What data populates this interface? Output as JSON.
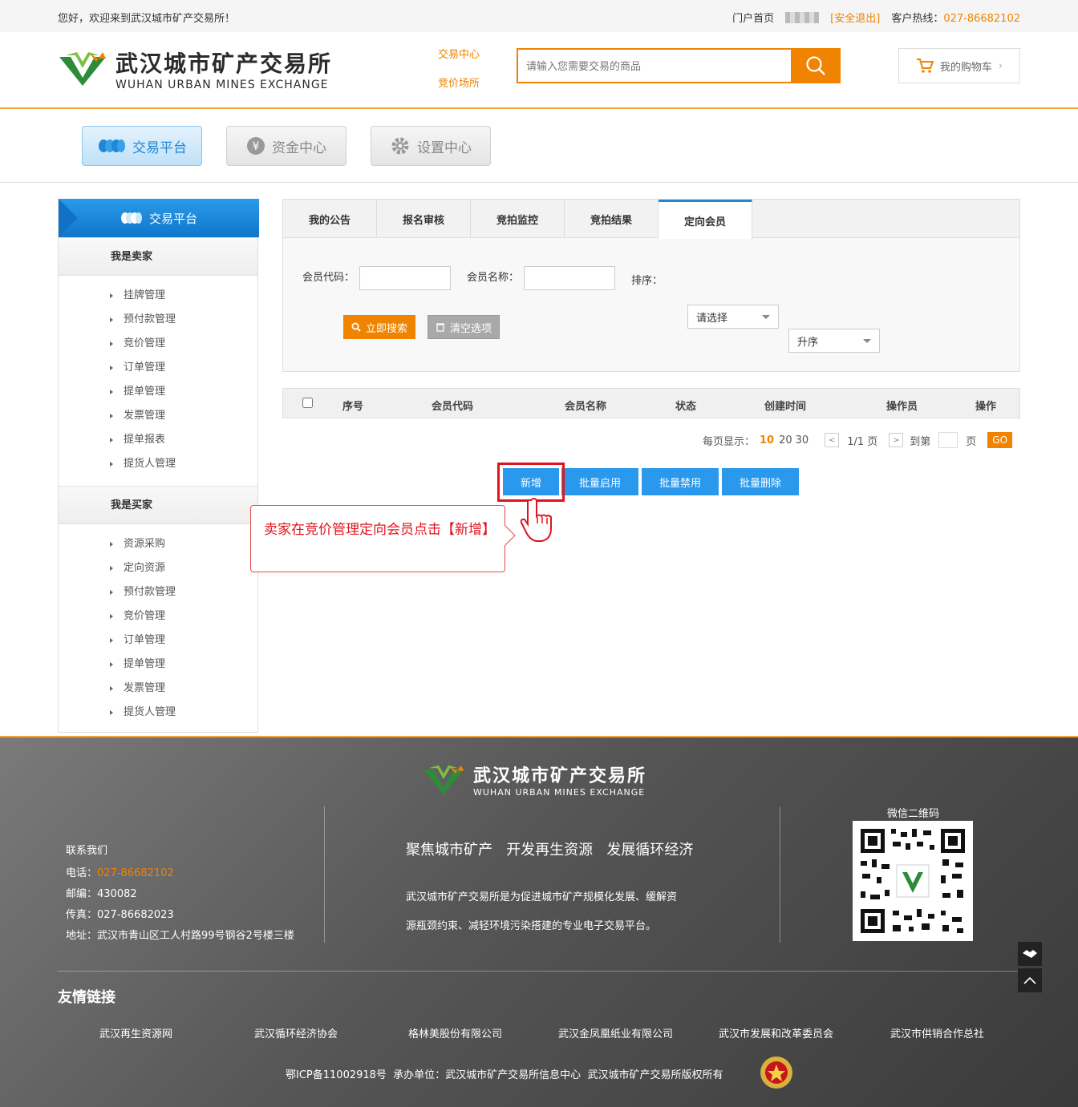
{
  "topbar": {
    "welcome": "您好，欢迎来到武汉城市矿产交易所！",
    "portal_home": "门户首页",
    "logout": "[安全退出]",
    "hotline_label": "客户热线：",
    "hotline": "027-86682102"
  },
  "header": {
    "logo_cn": "武汉城市矿产交易所",
    "logo_en": "WUHAN URBAN MINES EXCHANGE",
    "link_trade_center": "交易中心",
    "link_bidding_hall": "竞价场所",
    "search_placeholder": "请输入您需要交易的商品",
    "cart_label": "我的购物车"
  },
  "nav": {
    "tabs": [
      {
        "label": "交易平台",
        "icon": "coins-icon",
        "active": true
      },
      {
        "label": "资金中心",
        "icon": "yen-icon",
        "active": false
      },
      {
        "label": "设置中心",
        "icon": "gear-icon",
        "active": false
      }
    ]
  },
  "sidebar": {
    "title": "交易平台",
    "seller": {
      "title": "我是卖家",
      "items": [
        "挂牌管理",
        "预付款管理",
        "竞价管理",
        "订单管理",
        "提单管理",
        "发票管理",
        "提单报表",
        "提货人管理"
      ]
    },
    "buyer": {
      "title": "我是买家",
      "items": [
        "资源采购",
        "定向资源",
        "预付款管理",
        "竞价管理",
        "订单管理",
        "提单管理",
        "发票管理",
        "提货人管理"
      ]
    }
  },
  "main": {
    "tabs": [
      "我的公告",
      "报名审核",
      "竞拍监控",
      "竞拍结果",
      "定向会员"
    ],
    "filters": {
      "member_code_label": "会员代码：",
      "member_name_label": "会员名称：",
      "sort_label": "排序：",
      "sort_value": "请选择",
      "order_value": "升序",
      "search_btn": "立即搜索",
      "clear_btn": "清空选项"
    },
    "table_headers": [
      "序号",
      "会员代码",
      "会员名称",
      "状态",
      "创建时间",
      "操作员",
      "操作"
    ],
    "pager": {
      "per_page_label": "每页显示：",
      "per_page_current": "10",
      "per_page_20": "20",
      "per_page_30": "30",
      "page_info": "1/1 页",
      "goto_label": "到第",
      "page_unit": "页",
      "go": "GO"
    },
    "actions": [
      "新增",
      "批量启用",
      "批量禁用",
      "批量删除"
    ],
    "callout": "卖家在竞价管理定向会员点击【新增】"
  },
  "footer": {
    "logo_cn": "武汉城市矿产交易所",
    "logo_en": "WUHAN URBAN MINES EXCHANGE",
    "contact_title": "联系我们",
    "phone_label": "电话：",
    "phone": "027-86682102",
    "zip": "邮编：430082",
    "fax": "传真：027-86682023",
    "address": "地址：武汉市青山区工人村路99号钢谷2号楼三楼",
    "slogan": "聚焦城市矿产   开发再生资源   发展循环经济",
    "desc1": "武汉城市矿产交易所是为促进城市矿产规模化发展、缓解资",
    "desc2": "源瓶颈约束、减轻环境污染搭建的专业电子交易平台。",
    "qr_title": "微信二维码",
    "links_title": "友情链接",
    "links": [
      "武汉再生资源网",
      "武汉循环经济协会",
      "格林美股份有限公司",
      "武汉金凤凰纸业有限公司",
      "武汉市发展和改革委员会",
      "武汉市供销合作总社"
    ],
    "icp": "鄂ICP备11002918号  承办单位：武汉城市矿产交易所信息中心  武汉城市矿产交易所版权所有"
  }
}
